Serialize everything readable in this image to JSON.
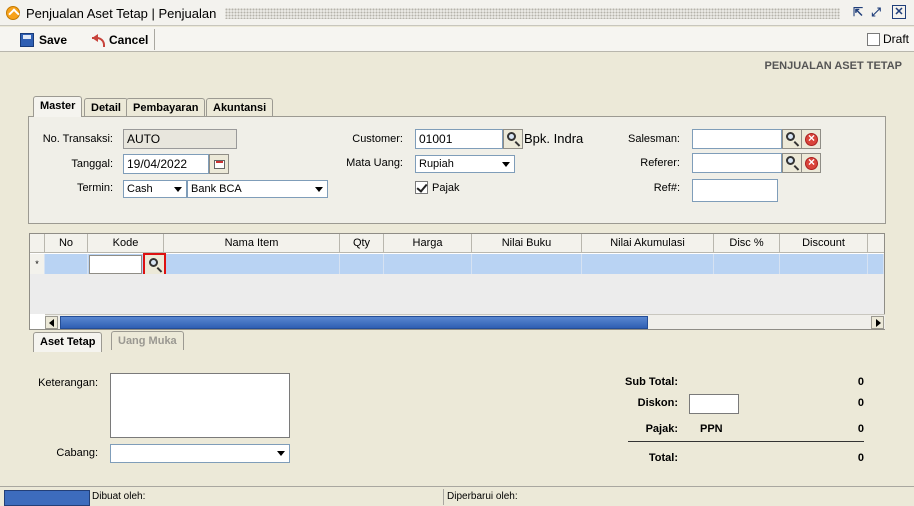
{
  "window": {
    "title": "Penjualan Aset Tetap | Penjualan"
  },
  "toolbar": {
    "save_label": "Save",
    "cancel_label": "Cancel",
    "draft_label": "Draft"
  },
  "page_heading": "PENJUALAN ASET TETAP",
  "tabs": [
    "Master",
    "Detail",
    "Pembayaran",
    "Akuntansi"
  ],
  "form": {
    "no_transaksi": {
      "label": "No. Transaksi:",
      "value": "AUTO"
    },
    "tanggal": {
      "label": "Tanggal:",
      "value": "19/04/2022"
    },
    "termin": {
      "label": "Termin:",
      "value": "Cash",
      "bank": "Bank BCA"
    },
    "customer": {
      "label": "Customer:",
      "code": "01001",
      "name": "Bpk. Indra"
    },
    "mata_uang": {
      "label": "Mata Uang:",
      "value": "Rupiah"
    },
    "pajak": {
      "label": "Pajak",
      "checked": true
    },
    "salesman": {
      "label": "Salesman:",
      "value": ""
    },
    "referer": {
      "label": "Referer:",
      "value": ""
    },
    "ref": {
      "label": "Ref#:",
      "value": ""
    }
  },
  "grid": {
    "columns": [
      "No",
      "Kode",
      "Nama Item",
      "Qty",
      "Harga",
      "Nilai Buku",
      "Nilai Akumulasi",
      "Disc %",
      "Discount"
    ],
    "new_row_marker": "*"
  },
  "bottom_tabs": [
    "Aset Tetap",
    "Uang Muka"
  ],
  "bottom": {
    "keterangan_label": "Keterangan:",
    "cabang_label": "Cabang:"
  },
  "summary": {
    "sub_total_label": "Sub Total:",
    "sub_total": "0",
    "diskon_label": "Diskon:",
    "diskon": "0",
    "pajak_label": "Pajak:",
    "pajak_type": "PPN",
    "pajak": "0",
    "total_label": "Total:",
    "total": "0"
  },
  "status": {
    "dibuat_oleh": "Dibuat oleh:",
    "diperbarui_oleh": "Diperbarui oleh:"
  }
}
